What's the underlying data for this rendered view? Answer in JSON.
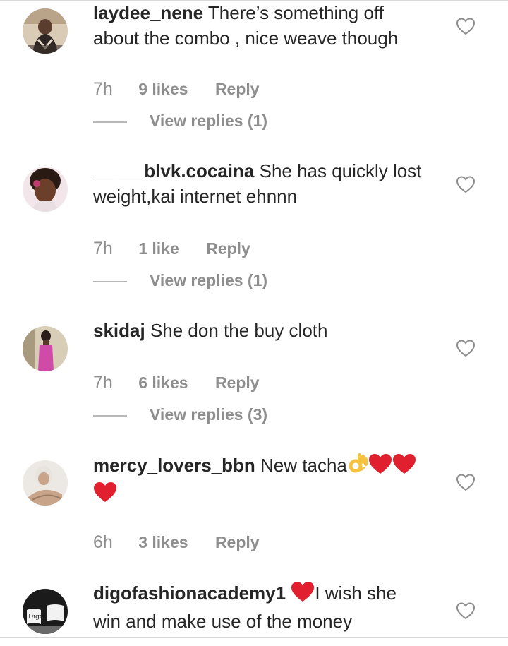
{
  "comments": [
    {
      "username": "laydee_nene",
      "text_line1": " There’s something off",
      "text_line2": "about the combo , nice weave though",
      "time": "7h",
      "likes": "9 likes",
      "reply": "Reply",
      "view_replies": "View replies (1)",
      "avatar_colors": [
        "#b9a48a",
        "#3a2e2a",
        "#e8dccc"
      ]
    },
    {
      "username": "_____blvk.cocaina",
      "text_line1": " She has quickly lost",
      "text_line2": "weight,kai internet ehnnn",
      "time": "7h",
      "likes": "1 like",
      "reply": "Reply",
      "view_replies": "View replies (1)",
      "avatar_colors": [
        "#c23b6e",
        "#2a1a14",
        "#f2e6ea"
      ]
    },
    {
      "username": "skidaj",
      "text_line1": " She don the buy cloth",
      "time": "7h",
      "likes": "6 likes",
      "reply": "Reply",
      "view_replies": "View replies (3)",
      "avatar_colors": [
        "#d04aa8",
        "#2b1e1a",
        "#d8cdb6"
      ]
    },
    {
      "username": "mercy_lovers_bbn",
      "text_line1": " New tacha",
      "time": "6h",
      "likes": "3 likes",
      "reply": "Reply",
      "avatar_colors": [
        "#e6e2de",
        "#c8a58a",
        "#ffffff"
      ]
    },
    {
      "username": "digofashionacademy1",
      "text_line1": "I wish she",
      "text_line2": "win and make use of the money",
      "avatar_colors": [
        "#1b1b1b",
        "#f2f2f2",
        "#6a6a6a"
      ]
    }
  ],
  "icons": {
    "like": "heart-outline-icon",
    "emoji_heart": "red-heart-emoji-icon",
    "emoji_ok": "ok-hand-emoji-icon"
  },
  "colors": {
    "text": "#262626",
    "secondary": "#8e8e8e",
    "heart_emoji": "#e0202e",
    "ok_emoji": "#f6c340"
  }
}
